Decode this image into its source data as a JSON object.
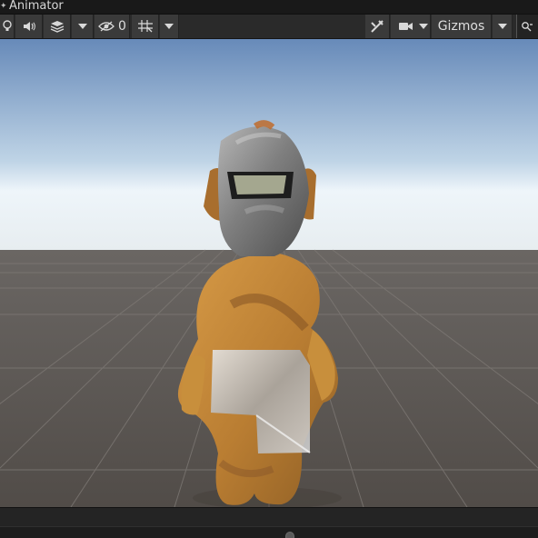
{
  "window": {
    "tab_title": "Animator",
    "tab_icon": "animator-icon"
  },
  "toolbar": {
    "left_items": [
      {
        "name": "scene-lighting-toggle",
        "icon": "lightbulb-icon"
      },
      {
        "name": "scene-audio-toggle",
        "icon": "speaker-icon"
      },
      {
        "name": "scene-effects-toggle",
        "icon": "layers-icon"
      },
      {
        "name": "scene-effects-dropdown",
        "icon": "chevron-down-icon"
      },
      {
        "name": "scene-visibility-toggle",
        "icon": "eye-slash-icon"
      },
      {
        "name": "grid-toggle",
        "icon": "grid-snap-icon"
      },
      {
        "name": "grid-dropdown",
        "icon": "chevron-down-icon"
      }
    ],
    "hidden_objects_count": "0",
    "right_items": [
      {
        "name": "tools-button",
        "icon": "tools-icon"
      },
      {
        "name": "camera-settings",
        "icon": "camera-icon"
      },
      {
        "name": "gizmos-dropdown",
        "icon": "chevron-down-icon"
      },
      {
        "name": "search-scene",
        "icon": "search-icon"
      }
    ],
    "gizmos_label": "Gizmos"
  },
  "scene": {
    "sky_top": "#6a86b0",
    "sky_bottom": "#e8f0f6",
    "ground": "#5d5a57",
    "grid_line": "#7a7775",
    "character_body": "#c58d3b",
    "character_shadow": "#8b5a25",
    "helmet": "#8f8f8f",
    "visor": "#a4a78f"
  },
  "bottom": {
    "scrollbar": "timeline-scrollbar",
    "handle": "slider-handle"
  }
}
